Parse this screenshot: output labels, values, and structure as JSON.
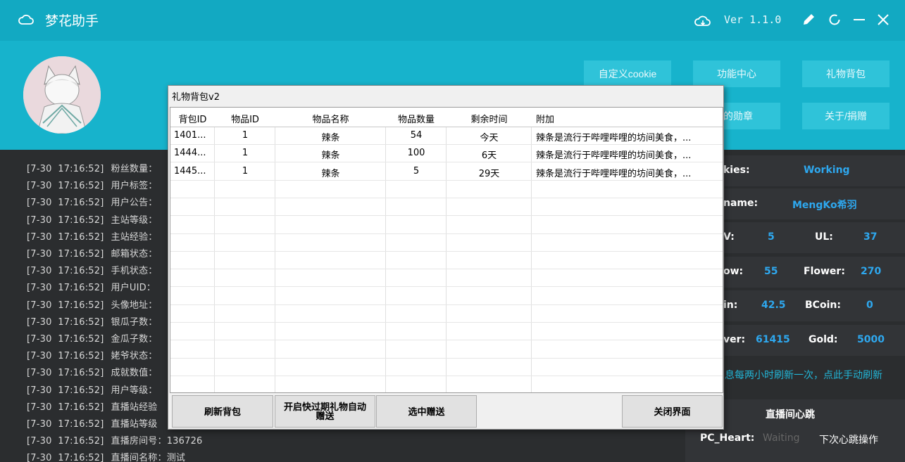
{
  "app": {
    "title": "梦花助手",
    "version": "Ver 1.1.0"
  },
  "header_buttons": {
    "custom_cookie": "自定义cookie",
    "function_center": "功能中心",
    "gift_bag": "礼物背包",
    "my_medal_partial": "的勋章",
    "about": "关于/捐赠"
  },
  "log": {
    "lines": [
      {
        "ts": "[7-30  17:16:52]",
        "text": "粉丝数量："
      },
      {
        "ts": "[7-30  17:16:52]",
        "text": "用户标签："
      },
      {
        "ts": "[7-30  17:16:52]",
        "text": "用户公告："
      },
      {
        "ts": "[7-30  17:16:52]",
        "text": "主站等级："
      },
      {
        "ts": "[7-30  17:16:52]",
        "text": "主站经验："
      },
      {
        "ts": "[7-30  17:16:52]",
        "text": "邮箱状态："
      },
      {
        "ts": "[7-30  17:16:52]",
        "text": "手机状态："
      },
      {
        "ts": "[7-30  17:16:52]",
        "text": "用户UID："
      },
      {
        "ts": "[7-30  17:16:52]",
        "text": "头像地址："
      },
      {
        "ts": "[7-30  17:16:52]",
        "text": "银瓜子数："
      },
      {
        "ts": "[7-30  17:16:52]",
        "text": "金瓜子数："
      },
      {
        "ts": "[7-30  17:16:52]",
        "text": "姥爷状态："
      },
      {
        "ts": "[7-30  17:16:52]",
        "text": "成就数值："
      },
      {
        "ts": "[7-30  17:16:52]",
        "text": "用户等级："
      },
      {
        "ts": "[7-30  17:16:52]",
        "text": "直播站经验"
      },
      {
        "ts": "[7-30  17:16:52]",
        "text": "直播站等级"
      },
      {
        "ts": "[7-30  17:16:52]",
        "text": "直播房间号：136726"
      },
      {
        "ts": "[7-30  17:16:52]",
        "text": "直播间名称：测试"
      }
    ]
  },
  "info": {
    "cookies_label": "kies:",
    "cookies_value": "Working",
    "name_label": "name:",
    "name_value": "MengKo希羽",
    "lv_label": "V:",
    "lv_value": "5",
    "ul_label": "UL:",
    "ul_value": "37",
    "follow_label": "ow:",
    "follow_value": "55",
    "flower_label": "Flower:",
    "flower_value": "270",
    "coin_label": "in:",
    "coin_value": "42.5",
    "bcoin_label": "BCoin:",
    "bcoin_value": "0",
    "silver_label": "ver:",
    "silver_value": "61415",
    "gold_label": "Gold:",
    "gold_value": "5000",
    "refresh_notice": "息每两小时刷新一次，点此手动刷新",
    "heartbeat_title": "直播间心跳",
    "pc_heart_label": "PC_Heart:",
    "pc_heart_value": "Waiting",
    "next_op": "下次心跳操作"
  },
  "dialog": {
    "title": "礼物背包v2",
    "columns": [
      "背包ID",
      "物品ID",
      "物品名称",
      "物品数量",
      "剩余时间",
      "附加"
    ],
    "rows": [
      [
        "1401...",
        "1",
        "辣条",
        "54",
        "今天",
        "辣条是流行于哔哩哔哩的坊间美食，..."
      ],
      [
        "1444...",
        "1",
        "辣条",
        "100",
        "6天",
        "辣条是流行于哔哩哔哩的坊间美食，..."
      ],
      [
        "1445...",
        "1",
        "辣条",
        "5",
        "29天",
        "辣条是流行于哔哩哔哩的坊间美食，..."
      ]
    ],
    "btn_refresh": "刷新背包",
    "btn_auto_line1": "开启快过期礼物自动",
    "btn_auto_line2": "赠送",
    "btn_send": "选中赠送",
    "btn_close": "关闭界面"
  },
  "colors": {
    "accent": "#17b3cc",
    "titlebar": "#12a9c2",
    "button": "#2fc3d9",
    "value_blue": "#2ea8ef"
  }
}
